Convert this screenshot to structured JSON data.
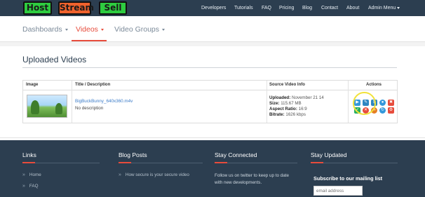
{
  "logo": {
    "part1": "Host",
    "part2": "Stream",
    "part3": "Sell"
  },
  "topnav": {
    "items": [
      "Developers",
      "Tutorials",
      "FAQ",
      "Pricing",
      "Blog",
      "Contact",
      "About"
    ],
    "admin_menu": "Admin Menu"
  },
  "subnav": {
    "dashboards": "Dashboards",
    "videos": "Videos",
    "video_groups": "Video Groups"
  },
  "page": {
    "title": "Uploaded Videos"
  },
  "table": {
    "headers": {
      "image": "Image",
      "title": "Title / Description",
      "source": "Source Video Info",
      "actions": "Actions"
    },
    "rows": [
      {
        "file_name": "BigBuckBunny_640x360.m4v",
        "description": "No description",
        "uploaded_label": "Uploaded:",
        "uploaded_value": "November 21 14",
        "size_label": "Size:",
        "size_value": "115.67 MB",
        "aspect_label": "Aspect Ratio:",
        "aspect_value": "16:9",
        "bitrate_label": "Bitrate:",
        "bitrate_value": "1626 kbps"
      }
    ]
  },
  "action_icons": [
    {
      "name": "video-icon",
      "color": "#3498db"
    },
    {
      "name": "edit-icon",
      "color": "#2e86c1"
    },
    {
      "name": "dollar-icon",
      "color": "#2e86c1"
    },
    {
      "name": "user-icon",
      "color": "#3498db"
    },
    {
      "name": "trash-icon",
      "color": "#e74c3c"
    },
    {
      "name": "check-icon",
      "color": "#27ae60"
    },
    {
      "name": "cross-icon",
      "color": "#e74c3c"
    },
    {
      "name": "link-icon",
      "color": "#e67e22"
    },
    {
      "name": "refresh-icon",
      "color": "#3498db"
    },
    {
      "name": "settings-icon",
      "color": "#e74c3c"
    }
  ],
  "footer": {
    "links_title": "Links",
    "links": [
      "Home",
      "FAQ"
    ],
    "blog_title": "Blog Posts",
    "blog_posts": [
      "How secure is your secure video"
    ],
    "connected_title": "Stay Connected",
    "connected_text": "Follow us on twitter to keep up to date with new developments.",
    "updated_title": "Stay Updated",
    "subscribe_label": "Subscribe to our mailing list",
    "email_placeholder": "email address"
  },
  "colors": {
    "navbar": "#2c3e50",
    "accent": "#e74c3c",
    "logo_green": "#2ecc40",
    "logo_orange": "#f0622d",
    "link": "#3a7bc8"
  }
}
